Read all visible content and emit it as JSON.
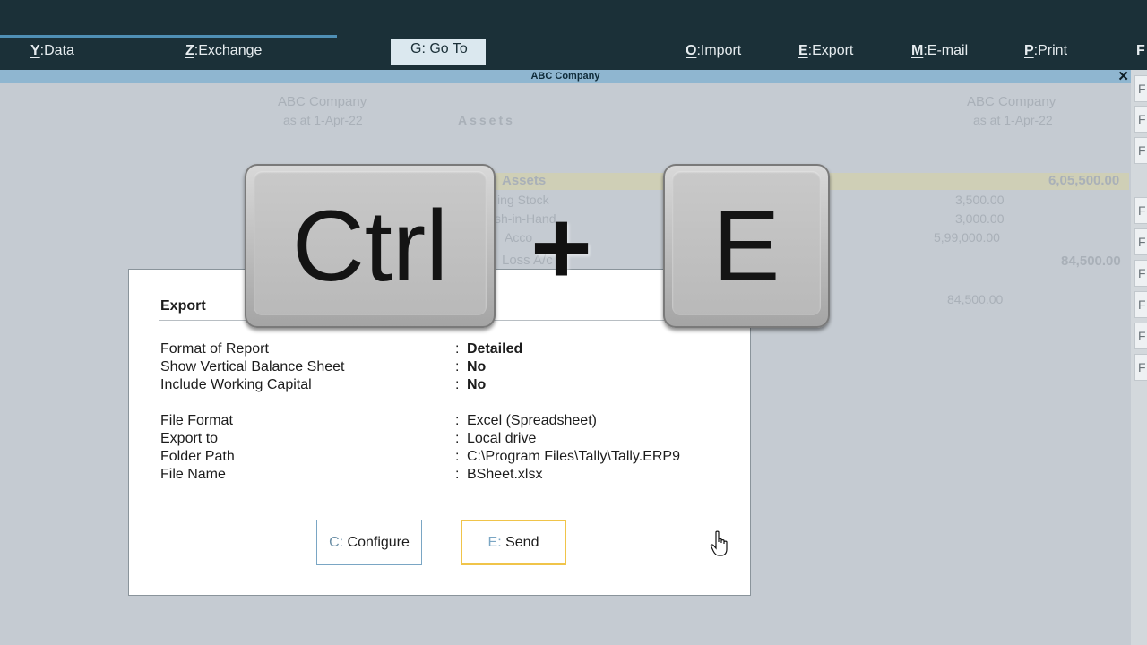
{
  "menu": {
    "items": [
      {
        "key": "Y",
        "label": "Data"
      },
      {
        "key": "Z",
        "label": "Exchange"
      },
      {
        "key": "G",
        "label": "Go To"
      },
      {
        "key": "O",
        "label": "Import"
      },
      {
        "key": "E",
        "label": "Export"
      },
      {
        "key": "M",
        "label": "E-mail"
      },
      {
        "key": "P",
        "label": "Print"
      }
    ],
    "overflow_label": "F"
  },
  "window": {
    "title": "ABC Company",
    "close_glyph": "✕"
  },
  "report": {
    "left_company": "ABC Company",
    "left_date": "as at 1-Apr-22",
    "section": "Assets",
    "right_company": "ABC Company",
    "right_date": "as at 1-Apr-22",
    "rows": [
      {
        "label": "Assets",
        "amount": "6,05,500.00"
      },
      {
        "label": "ing Stock",
        "amount": "3,500.00"
      },
      {
        "label": "sh-in-Hand",
        "amount": "3,000.00"
      },
      {
        "label": "Acco",
        "amount": "5,99,000.00"
      },
      {
        "label": "Loss A/c",
        "amount": "84,500.00"
      },
      {
        "label": "",
        "amount": "84,500.00"
      }
    ]
  },
  "side_buttons": [
    "F",
    "F",
    "F",
    "F",
    "F",
    "F",
    "F",
    "F",
    "F"
  ],
  "dialog": {
    "title": "Export",
    "fields_group1": [
      {
        "label": "Format of Report",
        "value": "Detailed"
      },
      {
        "label": "Show Vertical Balance Sheet",
        "value": "No"
      },
      {
        "label": "Include Working Capital",
        "value": "No"
      }
    ],
    "fields_group2": [
      {
        "label": "File Format",
        "value": "Excel (Spreadsheet)"
      },
      {
        "label": "Export to",
        "value": "Local drive"
      },
      {
        "label": "Folder Path",
        "value": "C:\\Program Files\\Tally\\Tally.ERP9"
      },
      {
        "label": "File Name",
        "value": "BSheet.xlsx"
      }
    ],
    "colon": ":",
    "buttons": {
      "configure": {
        "hotkey": "C:",
        "label": "Configure"
      },
      "send": {
        "hotkey": "E:",
        "label": "Send"
      }
    }
  },
  "overlay": {
    "key1": "Ctrl",
    "plus": "+",
    "key2": "E"
  },
  "colors": {
    "menu_bg": "#1b3038",
    "title_strip": "#8fb6d0",
    "send_border": "#f0c44a",
    "configure_border": "#7aa6c4"
  }
}
